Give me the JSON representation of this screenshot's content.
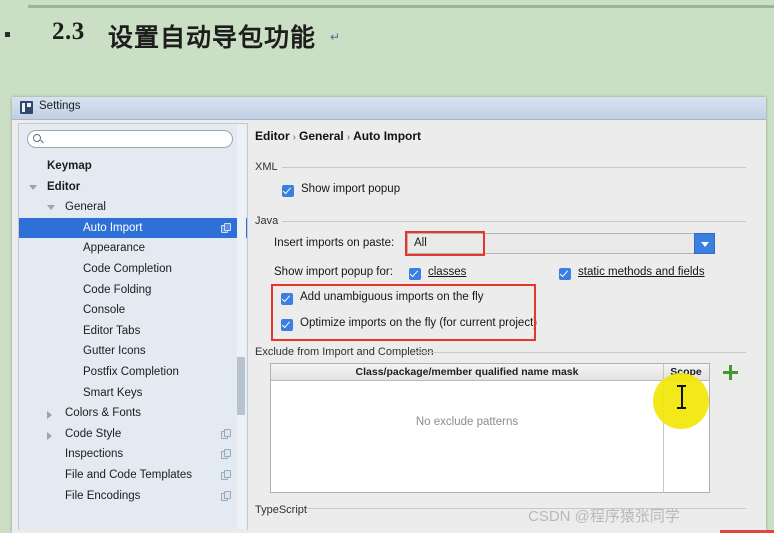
{
  "slide": {
    "bullet": "▪",
    "number": "2.3",
    "title": "设置自动导包功能",
    "title_mark": "↵"
  },
  "window": {
    "title": "Settings",
    "icon": "settings-window-icon"
  },
  "sidebar": {
    "search": {
      "value": "",
      "placeholder": "",
      "icon": "search-icon"
    },
    "items": [
      {
        "label": "Keymap",
        "indent": 28,
        "arrow": "none",
        "bold": true,
        "selected": false,
        "icon": false
      },
      {
        "label": "Editor",
        "indent": 28,
        "arrow": "down",
        "bold": true,
        "selected": false,
        "icon": false
      },
      {
        "label": "General",
        "indent": 46,
        "arrow": "down",
        "bold": false,
        "selected": false,
        "icon": false
      },
      {
        "label": "Auto Import",
        "indent": 64,
        "arrow": "none",
        "bold": false,
        "selected": true,
        "icon": true
      },
      {
        "label": "Appearance",
        "indent": 64,
        "arrow": "none",
        "bold": false,
        "selected": false,
        "icon": false
      },
      {
        "label": "Code Completion",
        "indent": 64,
        "arrow": "none",
        "bold": false,
        "selected": false,
        "icon": false
      },
      {
        "label": "Code Folding",
        "indent": 64,
        "arrow": "none",
        "bold": false,
        "selected": false,
        "icon": false
      },
      {
        "label": "Console",
        "indent": 64,
        "arrow": "none",
        "bold": false,
        "selected": false,
        "icon": false
      },
      {
        "label": "Editor Tabs",
        "indent": 64,
        "arrow": "none",
        "bold": false,
        "selected": false,
        "icon": false
      },
      {
        "label": "Gutter Icons",
        "indent": 64,
        "arrow": "none",
        "bold": false,
        "selected": false,
        "icon": false
      },
      {
        "label": "Postfix Completion",
        "indent": 64,
        "arrow": "none",
        "bold": false,
        "selected": false,
        "icon": false
      },
      {
        "label": "Smart Keys",
        "indent": 64,
        "arrow": "none",
        "bold": false,
        "selected": false,
        "icon": false
      },
      {
        "label": "Colors & Fonts",
        "indent": 46,
        "arrow": "right",
        "bold": false,
        "selected": false,
        "icon": false
      },
      {
        "label": "Code Style",
        "indent": 46,
        "arrow": "right",
        "bold": false,
        "selected": false,
        "icon": true
      },
      {
        "label": "Inspections",
        "indent": 46,
        "arrow": "none",
        "bold": false,
        "selected": false,
        "icon": true
      },
      {
        "label": "File and Code Templates",
        "indent": 46,
        "arrow": "none",
        "bold": false,
        "selected": false,
        "icon": true
      },
      {
        "label": "File Encodings",
        "indent": 46,
        "arrow": "none",
        "bold": false,
        "selected": false,
        "icon": true
      }
    ]
  },
  "content": {
    "breadcrumb": {
      "first": "Editor",
      "second": "General",
      "third": "Auto Import",
      "sep": "›"
    },
    "xml": {
      "section_label": "XML",
      "show_import_popup": {
        "label": "Show import popup",
        "checked": true
      }
    },
    "java": {
      "section_label": "Java",
      "insert_imports_label": "Insert imports on paste:",
      "insert_imports_value": "All",
      "show_popup_for_label": "Show import popup for:",
      "classes": {
        "label": "classes",
        "checked": true
      },
      "static_methods": {
        "label": "static methods and fields",
        "checked": true
      },
      "add_unambiguous": {
        "label": "Add unambiguous imports on the fly",
        "checked": true
      },
      "optimize_imports": {
        "label": "Optimize imports on the fly (for current project)",
        "checked": true
      }
    },
    "exclude": {
      "section_label": "Exclude from Import and Completion",
      "col_mask": "Class/package/member qualified name mask",
      "col_scope": "Scope",
      "empty_text": "No exclude patterns",
      "add_button": "+"
    },
    "typescript_section_label": "TypeScript"
  },
  "cursor": {
    "glyph": "text-ibeam-cursor"
  },
  "watermark": {
    "text": "CSDN @程序猿张同学"
  },
  "colors": {
    "slide_background": "#cbdfc4",
    "accent_blue": "#3b7fe0",
    "selection_blue": "#2f70d8",
    "highlight_red": "#e8352c",
    "cursor_yellow": "#f2e606",
    "plus_green": "#3f9b2e"
  }
}
